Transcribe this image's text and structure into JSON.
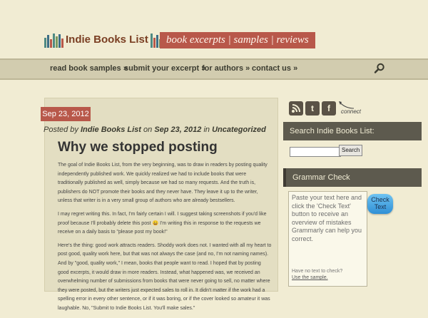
{
  "header": {
    "logo_text": "Indie Books List",
    "tagline": "book excerpts | samples | reviews"
  },
  "nav": {
    "items": [
      "read book samples »",
      "submit your excerpt »",
      "for authors »",
      "contact us »"
    ]
  },
  "post": {
    "date": "Sep 23, 2012",
    "byline": {
      "prefix": "Posted by",
      "author": "Indie Books List",
      "on": "on",
      "date": "Sep 23, 2012",
      "in": "in",
      "category": "Uncategorized"
    },
    "title": "Why we stopped posting",
    "paragraphs": [
      "The goal of Indie Books List, from the very beginning, was to draw in readers by posting quality independently published work. We quickly realized we had to include books that were traditionally published as well, simply because we had so many requests. And the truth is, publishers do NOT promote their books and they never have. They leave it up to the writer, unless that writer is in a very small group of authors who are already bestsellers.",
      "I may regret writing this. In fact, I'm fairly certain I will. I suggest taking screenshots if you'd like proof because I'll probably delete this post 😀 I'm writing this in response to the requests we receive on a daily basis to \"please post my book!\"",
      "Here's the thing: good work attracts readers. Shoddy work does not. I wanted with all my heart to post good, quality work here, but that was not always the case (and no, I'm not naming names). And by \"good, quality work,\" I mean, books that people want to read. I hoped that by posting good excerpts, it would draw in more readers. Instead, what happened was, we received an overwhelming number of submissions from books that were never going to sell, no matter where they were posted, but the writers just expected sales to roll in. It didn't matter if the work had a spelling error in every other sentence, or if it was boring, or if the cover looked so amateur it was laughable. No, \"Submit to Indie Books List. You'll make sales.\""
    ]
  },
  "sidebar": {
    "social": [
      "rss-icon",
      "twitter-icon",
      "facebook-icon"
    ],
    "connect_label": "connect",
    "search_title": "Search Indie Books List:",
    "search_value": "",
    "search_button": "Search",
    "grammar_title": "Grammar Check",
    "grammar_placeholder": "Paste your text here and click the 'Check Text' button to receive an overview of mistakes Grammarly can help you correct.",
    "grammar_note": "Have no text to check?",
    "grammar_link": "Use the sample.",
    "check_button": "Check Text"
  },
  "colors": {
    "background": "#f1ecd3",
    "accent": "#b8584a",
    "navbar": "#d2ccaf",
    "widget_header": "#5d5a4e",
    "check_button": "#3b9be0"
  }
}
